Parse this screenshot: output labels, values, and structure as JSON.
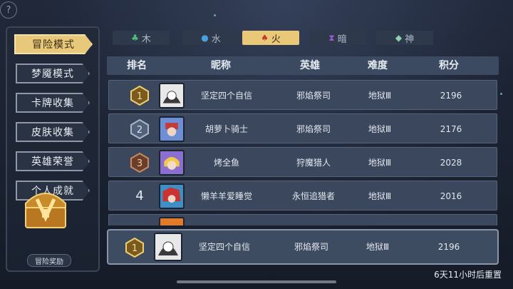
{
  "header": {
    "help_icon": "?"
  },
  "sidebar": {
    "items": [
      {
        "label": "冒险模式",
        "active": true
      },
      {
        "label": "梦魇模式",
        "active": false
      },
      {
        "label": "卡牌收集",
        "active": false
      },
      {
        "label": "皮肤收集",
        "active": false
      },
      {
        "label": "英雄荣誉",
        "active": false
      },
      {
        "label": "个人成就",
        "active": false
      }
    ],
    "reward_label": "冒险奖励"
  },
  "tabs": [
    {
      "icon": "leaf-icon",
      "glyph": "♣",
      "label": "木",
      "color": "#4fbf7a",
      "active": false
    },
    {
      "icon": "drop-icon",
      "glyph": "💧",
      "label": "水",
      "color": "#4aa0d8",
      "active": false
    },
    {
      "icon": "flame-icon",
      "glyph": "♠",
      "label": "火",
      "color": "#c23a2e",
      "active": true
    },
    {
      "icon": "hourglass-icon",
      "glyph": "⧗",
      "label": "暗",
      "color": "#9c5bd6",
      "active": false
    },
    {
      "icon": "crystal-icon",
      "glyph": "◆",
      "label": "神",
      "color": "#8fd0b0",
      "active": false
    }
  ],
  "table": {
    "headers": {
      "rank": "排名",
      "nickname": "昵称",
      "hero": "英雄",
      "difficulty": "难度",
      "score": "积分"
    },
    "rows": [
      {
        "rank": "1",
        "medal": "gold",
        "nickname": "坚定四个自信",
        "hero": "邪焰祭司",
        "difficulty": "地狱Ⅲ",
        "score": "2196"
      },
      {
        "rank": "2",
        "medal": "silver",
        "nickname": "胡萝卜骑士",
        "hero": "邪焰祭司",
        "difficulty": "地狱Ⅲ",
        "score": "2176"
      },
      {
        "rank": "3",
        "medal": "bronze",
        "nickname": "烤全鱼",
        "hero": "狩魔猎人",
        "difficulty": "地狱Ⅲ",
        "score": "2028"
      },
      {
        "rank": "4",
        "medal": "none",
        "nickname": "懒羊羊爱睡觉",
        "hero": "永恒追猎者",
        "difficulty": "地狱Ⅲ",
        "score": "2016"
      }
    ]
  },
  "my_entry": {
    "rank": "1",
    "nickname": "坚定四个自信",
    "hero": "邪焰祭司",
    "difficulty": "地狱Ⅲ",
    "score": "2196"
  },
  "footer": {
    "reset_text": "6天11小时后重置"
  },
  "colors": {
    "gold": "#e9c978",
    "panel": "#3a475c",
    "header": "#3b4a60"
  }
}
